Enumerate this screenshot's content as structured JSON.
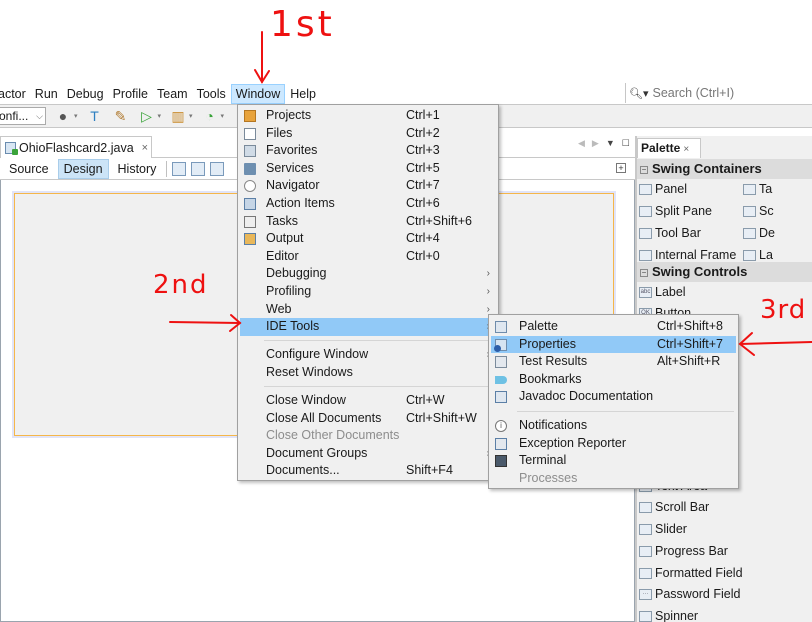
{
  "menubar": {
    "items": [
      "actor",
      "Run",
      "Debug",
      "Profile",
      "Team",
      "Tools",
      "Window",
      "Help"
    ],
    "active": "Window"
  },
  "search": {
    "placeholder": "Search (Ctrl+I)",
    "icon": "search-icon"
  },
  "toolbar": {
    "config_select": "onfi...",
    "icons": [
      "globe-icon",
      "build-hammer-icon",
      "clean-build-icon",
      "run-icon",
      "debug-icon",
      "profile-icon"
    ]
  },
  "editor": {
    "file_tab": "OhioFlashcard2.java",
    "file_tab_close": "×",
    "view_tabs": [
      "Source",
      "Design",
      "History"
    ],
    "active_view": "Design"
  },
  "palette": {
    "title": "Palette",
    "close": "×",
    "categories": [
      {
        "name": "Swing Containers",
        "items": [
          [
            "Panel",
            "Ta"
          ],
          [
            "Split Pane",
            "Sc"
          ],
          [
            "Tool Bar",
            "De"
          ],
          [
            "Internal Frame",
            "La"
          ]
        ]
      },
      {
        "name": "Swing Controls",
        "items": [
          "Label",
          "Button",
          "Text Area",
          "Scroll Bar",
          "Slider",
          "Progress Bar",
          "Formatted Field",
          "Password Field",
          "Spinner"
        ]
      }
    ]
  },
  "window_menu": {
    "items": [
      {
        "label": "Projects",
        "shortcut": "Ctrl+1",
        "icon": "projects-icon"
      },
      {
        "label": "Files",
        "shortcut": "Ctrl+2",
        "icon": "files-icon"
      },
      {
        "label": "Favorites",
        "shortcut": "Ctrl+3",
        "icon": "favorites-icon"
      },
      {
        "label": "Services",
        "shortcut": "Ctrl+5",
        "icon": "services-icon"
      },
      {
        "label": "Navigator",
        "shortcut": "Ctrl+7",
        "icon": "navigator-icon"
      },
      {
        "label": "Action Items",
        "shortcut": "Ctrl+6",
        "icon": "action-items-icon"
      },
      {
        "label": "Tasks",
        "shortcut": "Ctrl+Shift+6",
        "icon": "tasks-icon"
      },
      {
        "label": "Output",
        "shortcut": "Ctrl+4",
        "icon": "output-icon"
      },
      {
        "label": "Editor",
        "shortcut": "Ctrl+0"
      },
      {
        "label": "Debugging",
        "submenu": true
      },
      {
        "label": "Profiling",
        "submenu": true
      },
      {
        "label": "Web",
        "submenu": true
      },
      {
        "label": "IDE Tools",
        "submenu": true,
        "highlighted": true
      },
      {
        "label": "Configure Window",
        "submenu": true
      },
      {
        "label": "Reset Windows"
      },
      {
        "label": "Close Window",
        "shortcut": "Ctrl+W"
      },
      {
        "label": "Close All Documents",
        "shortcut": "Ctrl+Shift+W"
      },
      {
        "label": "Close Other Documents",
        "disabled": true
      },
      {
        "label": "Document Groups",
        "submenu": true
      },
      {
        "label": "Documents...",
        "shortcut": "Shift+F4"
      }
    ],
    "submenu_arrow": "›"
  },
  "ide_tools_submenu": {
    "items": [
      {
        "label": "Palette",
        "shortcut": "Ctrl+Shift+8",
        "icon": "palette-icon"
      },
      {
        "label": "Properties",
        "shortcut": "Ctrl+Shift+7",
        "icon": "properties-icon",
        "highlighted": true
      },
      {
        "label": "Test Results",
        "shortcut": "Alt+Shift+R",
        "icon": "test-results-icon"
      },
      {
        "label": "Bookmarks",
        "icon": "bookmarks-icon"
      },
      {
        "label": "Javadoc Documentation",
        "icon": "javadoc-icon"
      },
      {
        "label": "Notifications",
        "icon": "notifications-icon"
      },
      {
        "label": "Exception Reporter",
        "icon": "exception-reporter-icon"
      },
      {
        "label": "Terminal",
        "icon": "terminal-icon"
      },
      {
        "label": "Processes",
        "disabled": true
      }
    ]
  },
  "annotations": {
    "step1": "1st",
    "step2": "2nd",
    "step3": "3rd",
    "color": "#ee1111"
  },
  "colors": {
    "menu_highlight": "#91c9f7",
    "active_menu": "#cce8ff",
    "form_border": "#f5b649"
  }
}
